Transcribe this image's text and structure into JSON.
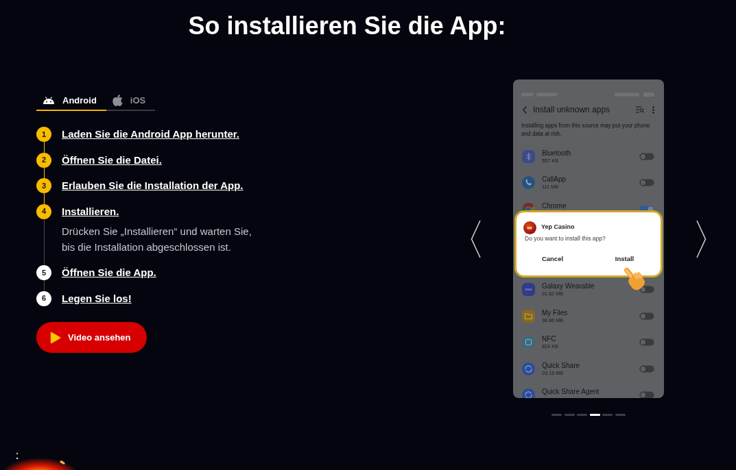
{
  "title": "So installieren Sie die App:",
  "tabs": [
    {
      "label": "Android",
      "kind": "android",
      "selected": true
    },
    {
      "label": "iOS",
      "kind": "apple",
      "selected": false
    }
  ],
  "steps": [
    {
      "number": "1",
      "title": "Laden Sie die Android App herunter.",
      "reached": true
    },
    {
      "number": "2",
      "title": "Öffnen Sie die Datei.",
      "reached": true
    },
    {
      "number": "3",
      "title": "Erlauben Sie die Installation der App.",
      "reached": true
    },
    {
      "number": "4",
      "title": "Installieren.",
      "reached": true,
      "description": "Drücken Sie „Installieren“ und warten Sie, bis die Installation abgeschlossen ist."
    },
    {
      "number": "5",
      "title": "Öffnen Sie die App.",
      "reached": false
    },
    {
      "number": "6",
      "title": "Legen Sie los!",
      "reached": false
    }
  ],
  "video_button": {
    "label": "Video ansehen"
  },
  "carousel": {
    "phone_screen": {
      "header": {
        "title": "Install unknown apps"
      },
      "notice": "Installing apps from this source may put your phone and data at risk.",
      "apps_above": [
        {
          "name": "Bluetooth",
          "size": "557 KB",
          "kind": "bluetooth",
          "on": false
        },
        {
          "name": "CallApp",
          "size": "111 MB",
          "kind": "callapp",
          "on": false
        },
        {
          "name": "Chrome",
          "kind": "chrome",
          "on": true
        }
      ],
      "dialog": {
        "app_name": "Yep Casino",
        "question": "Do you want to install this app?",
        "buttons": [
          "Cancel",
          "Install"
        ]
      },
      "apps_below": [
        {
          "name": "Galaxy Wearable",
          "size": "31.62 MB",
          "kind": "wearable",
          "on": false
        },
        {
          "name": "My Files",
          "size": "38.86 MB",
          "kind": "files",
          "on": false
        },
        {
          "name": "NFC",
          "size": "824 KB",
          "kind": "nfc",
          "on": false
        },
        {
          "name": "Quick Share",
          "size": "29.15 MB",
          "kind": "share",
          "on": false
        },
        {
          "name": "Quick Share Agent",
          "kind": "share",
          "on": false
        }
      ]
    },
    "slides": [
      {
        "selected": false
      },
      {
        "selected": false
      },
      {
        "selected": false
      },
      {
        "selected": true
      },
      {
        "selected": false
      },
      {
        "selected": false
      }
    ]
  }
}
